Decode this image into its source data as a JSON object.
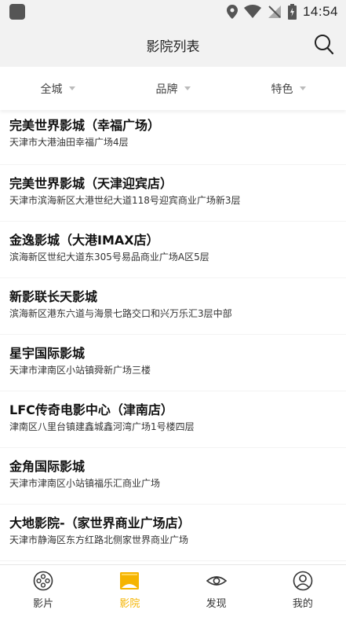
{
  "status_bar": {
    "time": "14:54"
  },
  "header": {
    "title": "影院列表",
    "search_icon": "search-icon"
  },
  "filters": [
    {
      "label": "全城"
    },
    {
      "label": "品牌"
    },
    {
      "label": "特色"
    }
  ],
  "cinemas": [
    {
      "name": "完美世界影城（幸福广场）",
      "address": "天津市大港油田幸福广场4层"
    },
    {
      "name": "完美世界影城（天津迎宾店）",
      "address": "天津市滨海新区大港世纪大道118号迎宾商业广场新3层"
    },
    {
      "name": "金逸影城（大港IMAX店）",
      "address": "滨海新区世纪大道东305号易品商业广场A区5层"
    },
    {
      "name": "新影联长天影城",
      "address": "滨海新区港东六道与海景七路交口和兴万乐汇3层中部"
    },
    {
      "name": "星宇国际影城",
      "address": "天津市津南区小站镇舜新广场三楼"
    },
    {
      "name": "LFC传奇电影中心（津南店）",
      "address": "津南区八里台镇建鑫城鑫河湾广场1号楼四层"
    },
    {
      "name": "金角国际影城",
      "address": "天津市津南区小站镇福乐汇商业广场"
    },
    {
      "name": "大地影院-（家世界商业广场店）",
      "address": "天津市静海区东方红路北侧家世界商业广场"
    }
  ],
  "tab_bar": [
    {
      "label": "影片",
      "icon": "film-reel-icon",
      "active": false
    },
    {
      "label": "影院",
      "icon": "cinema-screen-icon",
      "active": true
    },
    {
      "label": "发现",
      "icon": "eye-icon",
      "active": false
    },
    {
      "label": "我的",
      "icon": "user-profile-icon",
      "active": false
    }
  ],
  "colors": {
    "accent": "#f5b400",
    "header_bg": "#f2f2f2",
    "text": "#111111"
  }
}
